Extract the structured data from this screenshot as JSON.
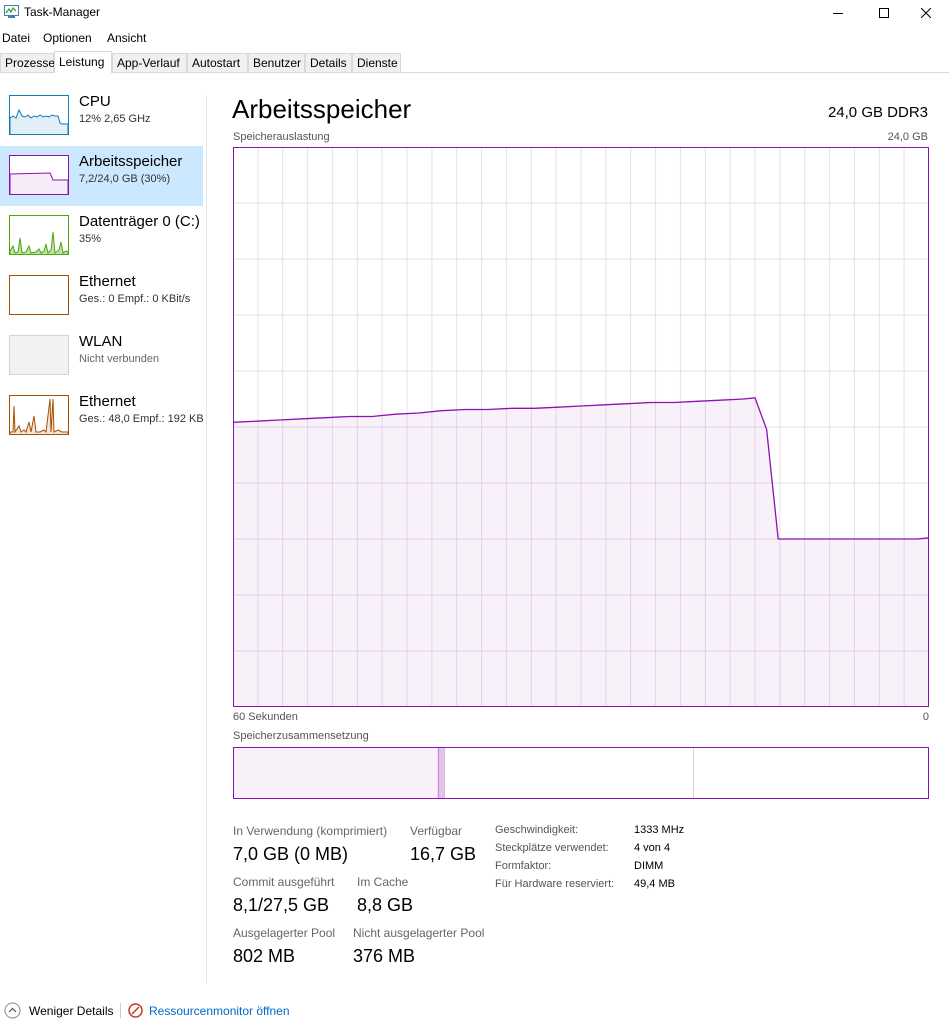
{
  "window": {
    "title": "Task-Manager"
  },
  "menu": [
    "Datei",
    "Optionen",
    "Ansicht"
  ],
  "tabs": [
    "Prozesse",
    "Leistung",
    "App-Verlauf",
    "Autostart",
    "Benutzer",
    "Details",
    "Dienste"
  ],
  "active_tab": "Leistung",
  "sidebar": [
    {
      "title": "CPU",
      "sub": "12%  2,65 GHz",
      "color": "#117dbb"
    },
    {
      "title": "Arbeitsspeicher",
      "sub": "7,2/24,0 GB (30%)",
      "color": "#8b12ae"
    },
    {
      "title": "Datenträger 0 (C:)",
      "sub": "35%",
      "color": "#4da60c"
    },
    {
      "title": "Ethernet",
      "sub": "Ges.: 0  Empf.: 0 KBit/s",
      "color": "#a74f01"
    },
    {
      "title": "WLAN",
      "sub": "Nicht verbunden",
      "color": "#999999"
    },
    {
      "title": "Ethernet",
      "sub": "Ges.: 48,0  Empf.: 192 KB",
      "color": "#a74f01"
    }
  ],
  "main": {
    "title": "Arbeitsspeicher",
    "spec": "24,0 GB DDR3",
    "usage_label": "Speicherauslastung",
    "usage_max": "24,0 GB",
    "time_left": "60 Sekunden",
    "time_right": "0",
    "composition_label": "Speicherzusammensetzung",
    "color": "#8b12ae"
  },
  "chart_data": {
    "type": "area",
    "x_unit": "seconds ago",
    "xlim": [
      60,
      0
    ],
    "ylim": [
      0,
      24
    ],
    "x": [
      60,
      58,
      56,
      54,
      52,
      50,
      48,
      46,
      44,
      42,
      40,
      38,
      36,
      34,
      32,
      30,
      28,
      26,
      24,
      22,
      20,
      18,
      16,
      15,
      14,
      13,
      12,
      10,
      8,
      6,
      4,
      2,
      1,
      0
    ],
    "values": [
      12.2,
      12.25,
      12.3,
      12.35,
      12.4,
      12.45,
      12.45,
      12.55,
      12.6,
      12.7,
      12.75,
      12.75,
      12.8,
      12.8,
      12.85,
      12.9,
      12.95,
      13.0,
      13.05,
      13.05,
      13.1,
      13.15,
      13.2,
      13.25,
      11.9,
      7.2,
      7.2,
      7.2,
      7.2,
      7.2,
      7.2,
      7.2,
      7.2,
      7.25
    ],
    "grid": true
  },
  "composition": {
    "segments": [
      {
        "name": "In Verwendung",
        "fraction": 0.295
      },
      {
        "name": "Geändert",
        "fraction": 0.009
      },
      {
        "name": "Standby",
        "fraction": 0.358
      },
      {
        "name": "Frei",
        "fraction": 0.338
      }
    ]
  },
  "stats": {
    "in_use_label": "In Verwendung (komprimiert)",
    "in_use_value": "7,0 GB (0 MB)",
    "available_label": "Verfügbar",
    "available_value": "16,7 GB",
    "commit_label": "Commit ausgeführt",
    "commit_value": "8,1/27,5 GB",
    "cache_label": "Im Cache",
    "cache_value": "8,8 GB",
    "paged_label": "Ausgelagerter Pool",
    "paged_value": "802 MB",
    "nonpaged_label": "Nicht ausgelagerter Pool",
    "nonpaged_value": "376 MB"
  },
  "specs": [
    {
      "label": "Geschwindigkeit:",
      "value": "1333 MHz"
    },
    {
      "label": "Steckplätze verwendet:",
      "value": "4 von 4"
    },
    {
      "label": "Formfaktor:",
      "value": "DIMM"
    },
    {
      "label": "Für Hardware reserviert:",
      "value": "49,4 MB"
    }
  ],
  "footer": {
    "less_details": "Weniger Details",
    "resource_monitor": "Ressourcenmonitor öffnen"
  }
}
